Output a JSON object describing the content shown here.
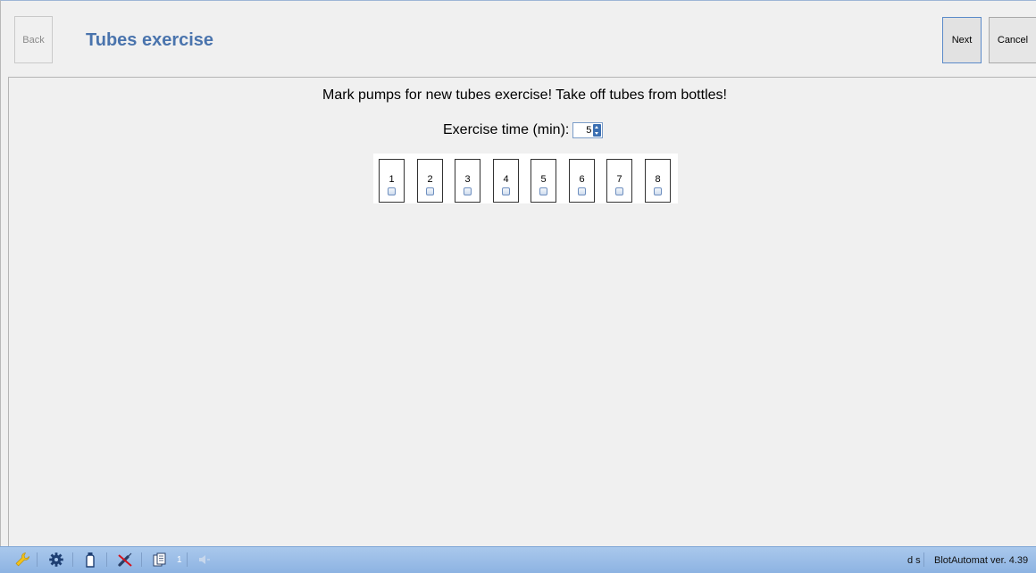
{
  "header": {
    "back_label": "Back",
    "title": "Tubes exercise",
    "next_label": "Next",
    "cancel_label": "Cancel"
  },
  "main": {
    "instruction": "Mark pumps for new tubes exercise!  Take off tubes from bottles!",
    "exercise_time_label": "Exercise time (min):",
    "exercise_time_value": "5",
    "pumps": [
      "1",
      "2",
      "3",
      "4",
      "5",
      "6",
      "7",
      "8"
    ]
  },
  "statusbar": {
    "icons": [
      "wrench-icon",
      "gear-icon",
      "bottle-icon",
      "syringe-disabled-icon",
      "documents-icon",
      "speaker-muted-icon"
    ],
    "documents_count": "1",
    "user": "d s",
    "version": "BlotAutomat ver. 4.39"
  },
  "colors": {
    "title": "#4a74ad",
    "statusbar": "#9bbde7",
    "next_border": "#5a8ac9"
  }
}
